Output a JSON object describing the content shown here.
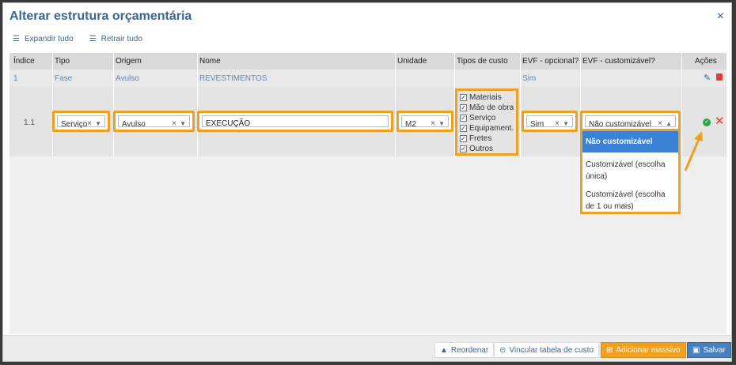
{
  "modal": {
    "title": "Alterar estrutura orçamentária",
    "close": "×"
  },
  "toolbar": {
    "expand_label": "Expandir tudo",
    "collapse_label": "Retrair tudo"
  },
  "table": {
    "headers": [
      "Índice",
      "Tipo",
      "Origem",
      "Nome",
      "Unidade",
      "Tipos de custo",
      "EVF - opcional?",
      "EVF - customizável?",
      "Ações"
    ],
    "row1": {
      "indice": "1",
      "tipo": "Fase",
      "origem": "Avulso",
      "nome": "REVESTIMENTOS",
      "evf_opcional": "Sim"
    },
    "row2": {
      "indice": "1.1",
      "tipo": "Serviço",
      "origem": "Avulso",
      "nome": "EXECUÇÃO",
      "unidade": "M2",
      "tipos_custo": [
        "Materiais",
        "Mão de obra",
        "Serviço",
        "Equipament...",
        "Fretes",
        "Outros"
      ],
      "evf_opcional": "Sim",
      "evf_customizavel": "Não customizável"
    }
  },
  "dropdown": {
    "options": [
      "Não customizável",
      "Customizável (escolha única)",
      "Customizável (escolha de 1 ou mais)"
    ]
  },
  "footer": {
    "reorder": "Reordenar",
    "link_table": "Vincular tabela de custo",
    "bulk_add": "Adicionar massivo",
    "save": "Salvar"
  },
  "colors": {
    "accent": "#3b6791",
    "highlight": "#f0a020",
    "danger": "#e53935",
    "success": "#28a745"
  }
}
